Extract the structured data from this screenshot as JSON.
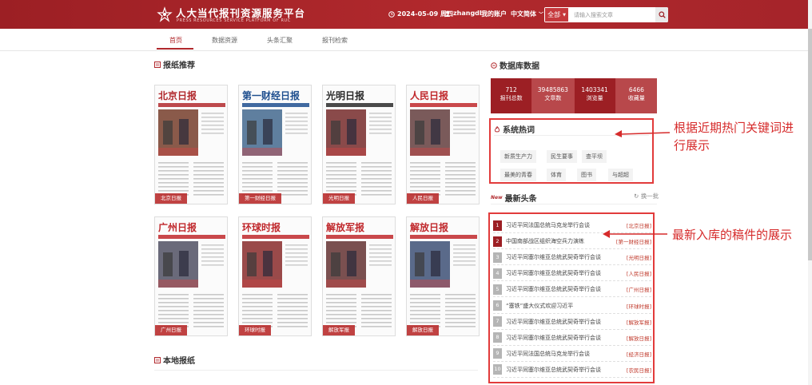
{
  "header": {
    "title": "人大当代报刊资源服务平台",
    "subtitle": "PRESS RESOURCES SERVICE PLATFORM OF RUC",
    "date": "2024-05-09 周四",
    "username": "zhangdl",
    "account_label": "我的账户",
    "lang_label": "中文简体",
    "search": {
      "scope": "全部",
      "placeholder": "请输入搜索文章"
    }
  },
  "nav": {
    "items": [
      "首页",
      "数据资源",
      "头条汇聚",
      "报刊检索"
    ]
  },
  "sections": {
    "recommend": "报纸推荐",
    "local": "本地报纸",
    "database": "数据库数据",
    "hot": "系统热词",
    "latest": "最新头条",
    "refresh": "换一批"
  },
  "newspapers": [
    {
      "masthead": "北京日报",
      "label": "北京日报"
    },
    {
      "masthead": "第一财经日报",
      "label": "第一财经日报"
    },
    {
      "masthead": "光明日报",
      "label": "光明日报"
    },
    {
      "masthead": "人民日报",
      "label": "人民日报"
    },
    {
      "masthead": "广州日报",
      "label": "广州日报"
    },
    {
      "masthead": "环球时报",
      "label": "环球时报"
    },
    {
      "masthead": "解放军报",
      "label": "解放军报"
    },
    {
      "masthead": "解放日报",
      "label": "解放日报"
    }
  ],
  "stats": [
    {
      "value": "712",
      "label": "报刊总数"
    },
    {
      "value": "39485863",
      "label": "文章数"
    },
    {
      "value": "1403341",
      "label": "浏览量"
    },
    {
      "value": "6466",
      "label": "收藏量"
    }
  ],
  "hot_tags": [
    "新质生产力",
    "民生要事",
    "查平坝",
    "最美的青春",
    "体育",
    "图书",
    "与超超"
  ],
  "headlines": [
    {
      "title": "习近平同法国总统马克龙举行会谈",
      "source": "[北京日报]"
    },
    {
      "title": "中国南部战区组织海空兵力演练",
      "source": "[第一财经日报]"
    },
    {
      "title": "习近平同塞尔维亚总统武契奇举行会谈",
      "source": "[光明日报]"
    },
    {
      "title": "习近平同塞尔维亚总统武契奇举行会谈",
      "source": "[人民日报]"
    },
    {
      "title": "习近平同塞尔维亚总统武契奇举行会谈",
      "source": "[广州日报]"
    },
    {
      "title": "“塞铁”盛大仪式欢迎习近平",
      "source": "[环球时报]"
    },
    {
      "title": "习近平同塞尔维亚总统武契奇举行会谈",
      "source": "[解放军报]"
    },
    {
      "title": "习近平同塞尔维亚总统武契奇举行会谈",
      "source": "[解放日报]"
    },
    {
      "title": "习近平同法国总统马克龙举行会谈",
      "source": "[经济日报]"
    },
    {
      "title": "习近平同塞尔维亚总统武契奇举行会谈",
      "source": "[农民日报]"
    }
  ],
  "annotations": {
    "hot": "根据近期热门关键词进行展示",
    "latest": "最新入库的稿件的展示"
  },
  "colors": {
    "brand": "#9c1f24",
    "accent": "#b1292d",
    "annotation": "#d62b2b"
  }
}
